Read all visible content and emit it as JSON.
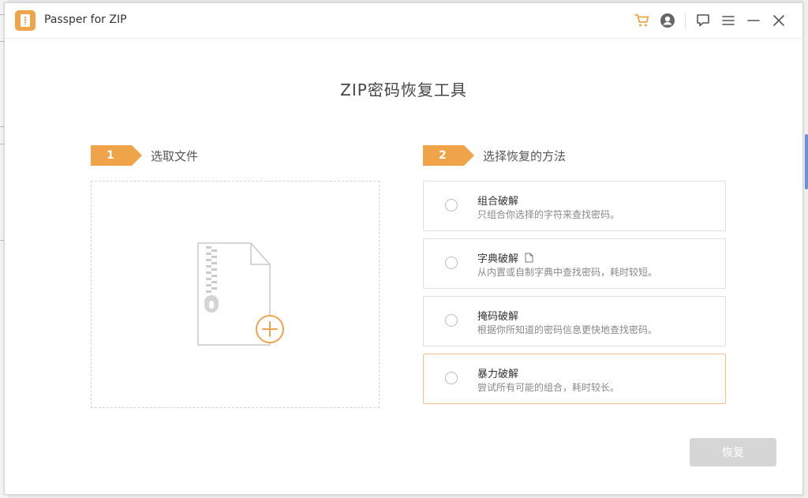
{
  "titlebar": {
    "app_title": "Passper for ZIP",
    "icons": [
      "cart-icon",
      "account-icon",
      "feedback-icon",
      "menu-icon",
      "minimize-icon",
      "close-icon"
    ],
    "accent": "#f0a44a"
  },
  "main": {
    "title": "ZIP密码恢复工具",
    "step1": {
      "number": "1",
      "label": "选取文件"
    },
    "step2": {
      "number": "2",
      "label": "选择恢复的方法"
    },
    "methods": [
      {
        "title": "组合破解",
        "desc": "只组合你选择的字符来查找密码。",
        "selected": false
      },
      {
        "title": "字典破解",
        "desc": "从内置或自制字典中查找密码，耗时较短。",
        "selected": false,
        "icon": "document-icon"
      },
      {
        "title": "掩码破解",
        "desc": "根据你所知道的密码信息更快地查找密码。",
        "selected": false
      },
      {
        "title": "暴力破解",
        "desc": "尝试所有可能的组合，耗时较长。",
        "selected": false,
        "highlighted": true
      }
    ],
    "restore_label": "恢复"
  }
}
